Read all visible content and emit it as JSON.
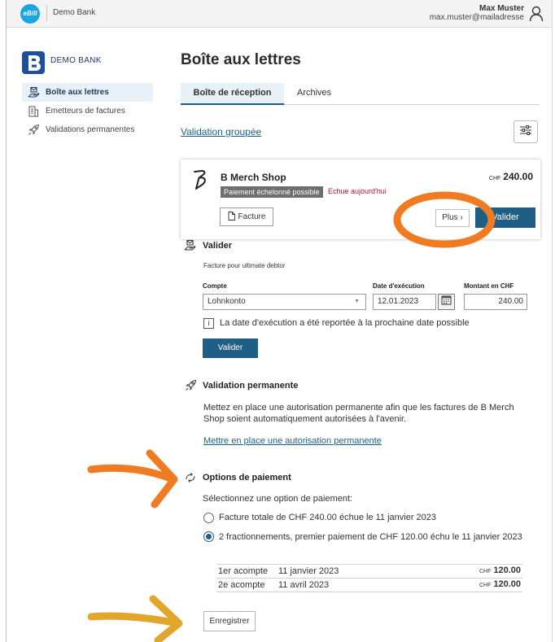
{
  "topbar": {
    "logo_text": "eBill",
    "bank_name": "Demo Bank",
    "user_name": "Max Muster",
    "user_email": "max.muster@mailadresse"
  },
  "sidebar": {
    "brand": "DEMO BANK",
    "items": [
      {
        "label": "Boîte aux lettres",
        "icon": "mailbox-hand-icon",
        "active": true
      },
      {
        "label": "Emetteurs de factures",
        "icon": "building-icon",
        "active": false
      },
      {
        "label": "Validations permanentes",
        "icon": "rocket-icon",
        "active": false
      }
    ]
  },
  "main": {
    "title": "Boîte aux lettres",
    "tabs": [
      {
        "label": "Boîte de réception",
        "active": true
      },
      {
        "label": "Archives",
        "active": false
      }
    ],
    "group_validation_link": "Validation groupée"
  },
  "invoice": {
    "merchant": "B Merch Shop",
    "badge": "Paiement échelonné possible",
    "due": "Echue aujourd'hui",
    "currency": "CHF",
    "amount": "240.00",
    "facture_button": "Facture",
    "plus_button": "Plus ›",
    "valider_button": "Valider"
  },
  "validate_section": {
    "title": "Valider",
    "subtitle": "Facture pour ultimate debtor",
    "account_label": "Compte",
    "account_value": "Lohnkonto",
    "date_label": "Date d'exécution",
    "date_value": "12.01.2023",
    "amount_label": "Montant en CHF",
    "amount_value": "240.00",
    "info_symbol": "i",
    "info_text": "La date d'exécution a été reportée à la prochaine date possible",
    "valider_button": "Valider"
  },
  "permanent_section": {
    "title": "Validation permanente",
    "text": "Mettez en place une autorisation permanente afin que les factures de B Merch Shop soient automatiquement autorisées à l'avenir.",
    "link": "Mettre en place une autorisation permanente"
  },
  "payment_options": {
    "title": "Options de paiement",
    "prompt": "Sélectionnez une option de paiement:",
    "option1": "Facture totale de CHF 240.00 échue le 11 janvier 2023",
    "option2": "2 fractionnements, premier paiement de CHF 120.00 échu le 11 janvier 2023",
    "selected": 2,
    "installments": [
      {
        "label": "1er acompte",
        "date": "11 janvier 2023",
        "currency": "CHF",
        "amount": "120.00"
      },
      {
        "label": "2e acompte",
        "date": "11 avril 2023",
        "currency": "CHF",
        "amount": "120.00"
      }
    ],
    "save_button": "Enregistrer"
  },
  "colors": {
    "primary": "#1f5f86",
    "accent_orange": "#ef7c22",
    "accent_gold": "#e0a72c",
    "due_red": "#b3123b",
    "nav_active_bg": "#e9f1f8"
  }
}
